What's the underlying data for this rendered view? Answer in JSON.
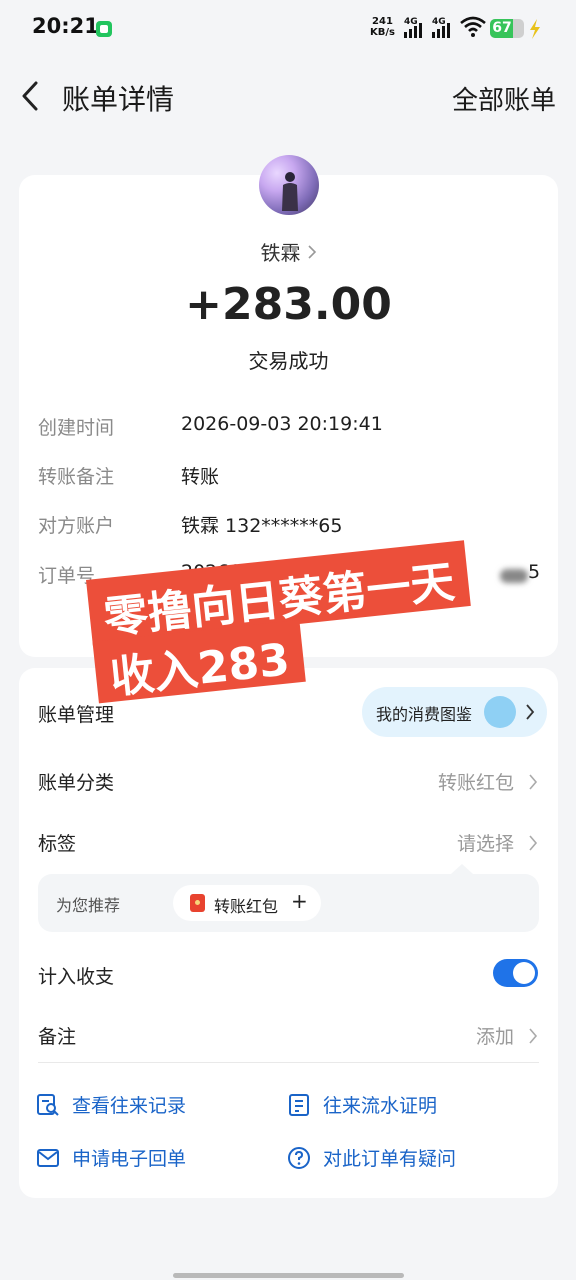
{
  "status_bar": {
    "time": "20:21",
    "net_speed_value": "241",
    "net_speed_unit": "KB/s",
    "sim1_label": "4G",
    "sim2_label": "4G",
    "battery_level": "67",
    "battery_fill_fraction": 0.67
  },
  "header": {
    "title": "账单详情",
    "right_link": "全部账单"
  },
  "transaction": {
    "payee": "铁霖",
    "amount": "+283.00",
    "status": "交易成功",
    "details": [
      {
        "label": "创建时间",
        "value": "2026-09-03 20:19:41"
      },
      {
        "label": "转账备注",
        "value": "转账"
      },
      {
        "label": "对方账户",
        "value": "铁霖 132******65"
      },
      {
        "label": "订单号",
        "value": "20260903209",
        "value_line2": "65",
        "value_tail": "5"
      }
    ]
  },
  "overlay": {
    "line1": "零撸向日葵第一天",
    "line2": "收入283"
  },
  "management": {
    "title": "账单管理",
    "consume_pill": "我的消费图鉴",
    "category_label": "账单分类",
    "category_value": "转账红包",
    "tag_label": "标签",
    "tag_value": "请选择",
    "suggest_label": "为您推荐",
    "suggest_chip": "转账红包",
    "include_label": "计入收支",
    "include_on": true,
    "note_label": "备注",
    "note_value": "添加",
    "actions": [
      {
        "label": "查看往来记录",
        "icon": "records-search-icon"
      },
      {
        "label": "往来流水证明",
        "icon": "statement-icon"
      },
      {
        "label": "申请电子回单",
        "icon": "mail-icon"
      },
      {
        "label": "对此订单有疑问",
        "icon": "question-icon"
      }
    ]
  },
  "colors": {
    "accent_blue": "#1f73e8",
    "link_blue": "#1a64c8",
    "sticker_red": "#ec4f3a",
    "battery_green": "#37c45a"
  }
}
